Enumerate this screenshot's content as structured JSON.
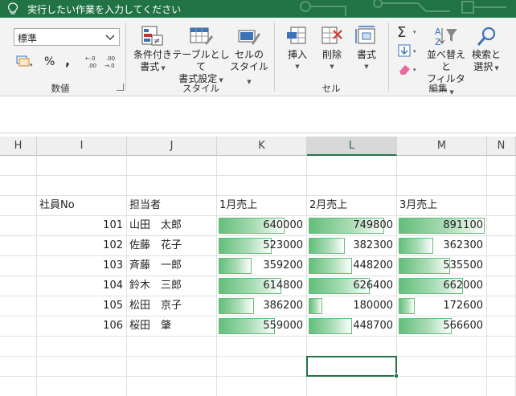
{
  "tell_me": {
    "text": "実行したい作業を入力してください"
  },
  "ribbon": {
    "number_format": {
      "value": "標準"
    },
    "number_group": {
      "percent": "%",
      "comma": ",",
      "label": "数値"
    },
    "style_group": {
      "label": "スタイル",
      "conditional_format": [
        "条件付き",
        "書式"
      ],
      "format_as_table": [
        "テーブルとして",
        "書式設定"
      ],
      "cell_styles": [
        "セルの",
        "スタイル"
      ]
    },
    "cells_group": {
      "label": "セル",
      "insert": "挿入",
      "delete": "削除",
      "format": "書式"
    },
    "edit_group": {
      "label": "編集",
      "sort_filter": [
        "並べ替えと",
        "フィルター"
      ],
      "find_select": [
        "検索と",
        "選択"
      ]
    }
  },
  "sheet": {
    "columns": [
      "H",
      "I",
      "J",
      "K",
      "L",
      "M",
      "N"
    ],
    "selected_column": "L",
    "headers": {
      "id": "社員No",
      "name": "担当者",
      "jan": "1月売上",
      "feb": "2月売上",
      "mar": "3月売上"
    },
    "rows": [
      {
        "id": "101",
        "name": "山田　太郎",
        "jan": "640000",
        "feb": "749800",
        "mar": "891100"
      },
      {
        "id": "102",
        "name": "佐藤　花子",
        "jan": "523000",
        "feb": "382300",
        "mar": "362300"
      },
      {
        "id": "103",
        "name": "斉藤　一郎",
        "jan": "359200",
        "feb": "448200",
        "mar": "535500"
      },
      {
        "id": "104",
        "name": "鈴木　三郎",
        "jan": "614800",
        "feb": "626400",
        "mar": "662000"
      },
      {
        "id": "105",
        "name": "松田　京子",
        "jan": "386200",
        "feb": "180000",
        "mar": "172600"
      },
      {
        "id": "106",
        "name": "桜田　肇",
        "jan": "559000",
        "feb": "448700",
        "mar": "566600"
      }
    ],
    "databar_fill": {
      "jan": [
        0.77,
        0.62,
        0.38,
        0.73,
        0.41,
        0.65
      ],
      "feb": [
        0.88,
        0.42,
        0.5,
        0.71,
        0.16,
        0.5
      ],
      "mar": [
        1.0,
        0.4,
        0.6,
        0.75,
        0.19,
        0.62
      ]
    },
    "colors": {
      "databar": "#63be7b",
      "accent": "#217346"
    }
  }
}
